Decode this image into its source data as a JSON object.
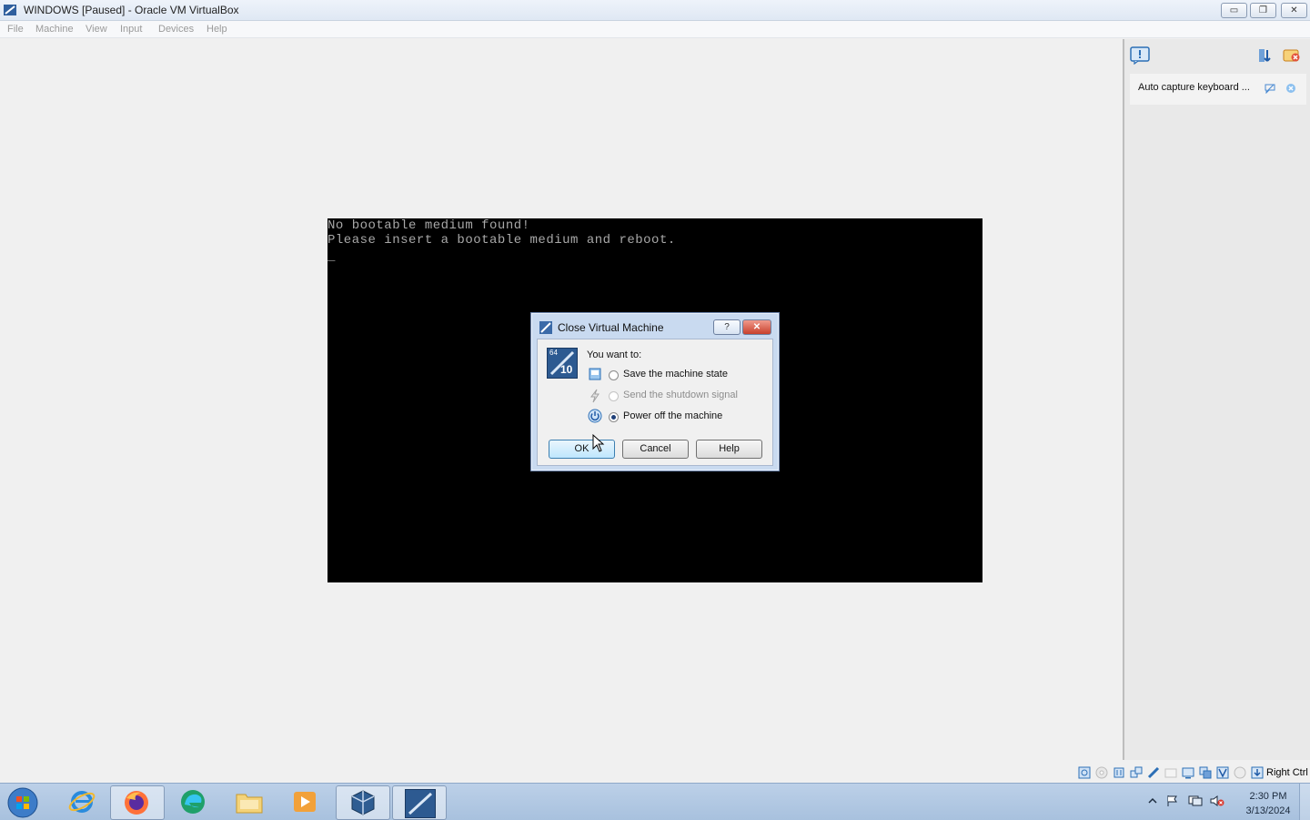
{
  "window": {
    "title": "WINDOWS [Paused] - Oracle VM VirtualBox",
    "buttons": {
      "minimize": "▭",
      "restore": "❐",
      "close": "✕"
    }
  },
  "menu": [
    "File",
    "Machine",
    "View",
    "Input",
    "Devices",
    "Help"
  ],
  "vm_screen": {
    "lines": [
      "No bootable medium found!",
      "Please insert a bootable medium and reboot.",
      "_"
    ]
  },
  "notification": {
    "text": "Auto capture keyboard ..."
  },
  "dialog": {
    "title": "Close Virtual Machine",
    "help_btn": "?",
    "close_btn": "✕",
    "prompt": "You want to:",
    "os_badge": "10",
    "os_badge_top": "64",
    "options": [
      {
        "label": "Save the machine state",
        "selected": false,
        "enabled": true
      },
      {
        "label": "Send the shutdown signal",
        "selected": false,
        "enabled": false
      },
      {
        "label": "Power off the machine",
        "selected": true,
        "enabled": true
      }
    ],
    "ok": "OK",
    "cancel": "Cancel",
    "help": "Help"
  },
  "statusbar": {
    "host_key": "Right Ctrl"
  },
  "taskbar": {
    "time": "2:30 PM",
    "date": "3/13/2024",
    "apps": [
      "start",
      "internet-explorer",
      "firefox",
      "edge",
      "file-explorer",
      "media-player",
      "virtualbox",
      "virtualbox-vm"
    ]
  },
  "colors": {
    "accent": "#1e3f78",
    "vm_text": "#a8a8a8"
  }
}
